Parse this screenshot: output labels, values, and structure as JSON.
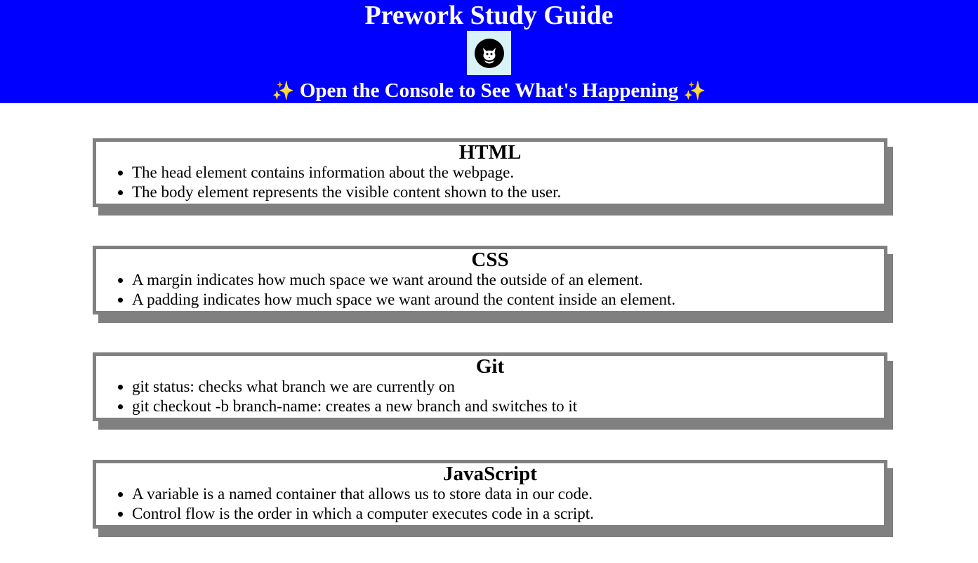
{
  "header": {
    "title": "Prework Study Guide",
    "logo_icon": "cat-face-icon",
    "subtitle": "Open the Console to See What's Happening",
    "sparkle": "✨"
  },
  "sections": [
    {
      "title": "HTML",
      "items": [
        "The head element contains information about the webpage.",
        "The body element represents the visible content shown to the user."
      ]
    },
    {
      "title": "CSS",
      "items": [
        "A margin indicates how much space we want around the outside of an element.",
        "A padding indicates how much space we want around the content inside an element."
      ]
    },
    {
      "title": "Git",
      "items": [
        "git status: checks what branch we are currently on",
        "git checkout -b branch-name: creates a new branch and switches to it"
      ]
    },
    {
      "title": "JavaScript",
      "items": [
        "A variable is a named container that allows us to store data in our code.",
        "Control flow is the order in which a computer executes code in a script."
      ]
    }
  ],
  "colors": {
    "header_bg": "#0000ff",
    "card_border": "#808080",
    "logo_bg": "#d9f2f7"
  }
}
